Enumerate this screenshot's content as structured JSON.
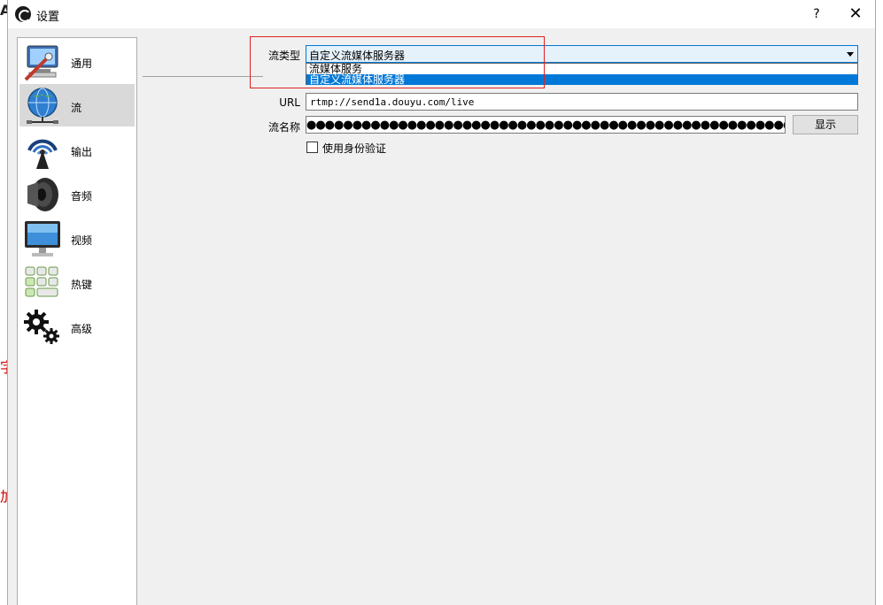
{
  "window": {
    "title": "设置",
    "help_symbol": "?",
    "close_symbol": "✕"
  },
  "sidebar": {
    "items": [
      {
        "label": "通用",
        "icon": "monitor-wrench-icon"
      },
      {
        "label": "流",
        "icon": "globe-network-icon",
        "selected": true
      },
      {
        "label": "输出",
        "icon": "broadcast-antenna-icon"
      },
      {
        "label": "音频",
        "icon": "speaker-icon"
      },
      {
        "label": "视频",
        "icon": "display-monitor-icon"
      },
      {
        "label": "热键",
        "icon": "keyboard-keys-icon"
      },
      {
        "label": "高级",
        "icon": "gears-icon"
      }
    ]
  },
  "stream": {
    "type_label": "流类型",
    "type_value": "自定义流媒体服务器",
    "type_options": [
      "流媒体服务",
      "自定义流媒体服务器"
    ],
    "url_label": "URL",
    "url_value": "rtmp://send1a.douyu.com/live",
    "key_label": "流名称",
    "key_value": "●●●●●●●●●●●●●●●●●●●●●●●●●●●●●●●●●●●●●●●●●●●●●●●●●●●●●●●●●●●●●●●",
    "show_button": "显示",
    "auth_label": "使用身份验证"
  },
  "colors": {
    "accent": "#0078d7",
    "highlight_box": "#e02020",
    "selected_nav": "#d9d9d9"
  }
}
